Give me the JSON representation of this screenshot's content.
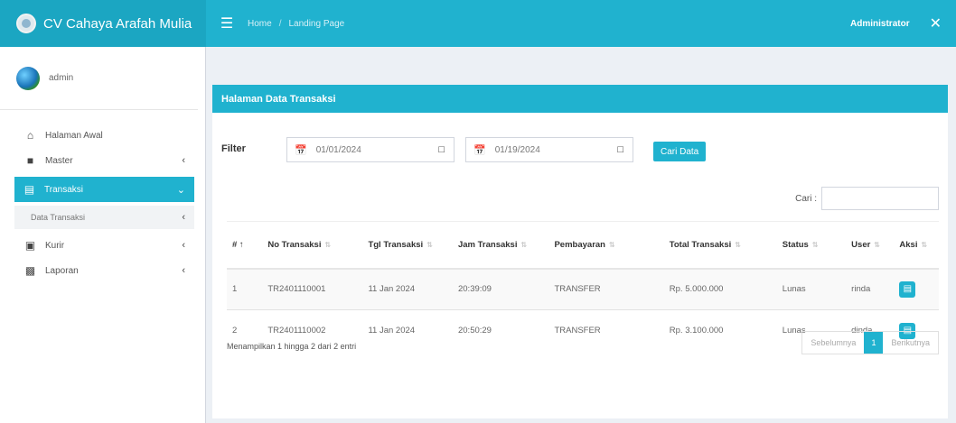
{
  "app": {
    "name": "CV Cahaya Arafah Mulia"
  },
  "header": {
    "breadcrumbs": [
      "Home",
      "Landing Page"
    ],
    "user": "Administrator"
  },
  "sidebar": {
    "user_name": "admin",
    "items": [
      {
        "label": "Halaman Awal",
        "icon": "home-icon",
        "chevron": false
      },
      {
        "label": "Master",
        "icon": "folder-icon",
        "chevron": true
      },
      {
        "label": "Transaksi",
        "icon": "table-icon",
        "chevron": true,
        "active": true
      },
      {
        "label": "Data Transaksi",
        "submenu": true,
        "chevron": true
      },
      {
        "label": "Kurir",
        "icon": "courier-icon",
        "chevron": true
      },
      {
        "label": "Laporan",
        "icon": "book-icon",
        "chevron": true
      }
    ]
  },
  "box": {
    "title": "Halaman Data Transaksi",
    "filter_label": "Filter",
    "date_from": "01/01/2024",
    "date_to": "01/19/2024",
    "search_button": "Cari Data",
    "search_label": "Cari :"
  },
  "table": {
    "headers": [
      "# ↑",
      "No Transaksi",
      "Tgl Transaksi",
      "Jam Transaksi",
      "Pembayaran",
      "Total Transaksi",
      "Status",
      "User",
      "Aksi"
    ],
    "rows": [
      [
        "1",
        "TR2401110001",
        "11 Jan 2024",
        "20:39:09",
        "TRANSFER",
        "Rp. 5.000.000",
        "Lunas",
        "rinda"
      ],
      [
        "2",
        "TR2401110002",
        "11 Jan 2024",
        "20:50:29",
        "TRANSFER",
        "Rp. 3.100.000",
        "Lunas",
        "dinda"
      ]
    ]
  },
  "footer": {
    "info": "Menampilkan 1 hingga 2 dari 2 entri",
    "prev": "Sebelumnya",
    "page": "1",
    "next": "Berikutnya"
  },
  "colors": {
    "accent": "#20b2cf",
    "background": "#ecf0f5"
  }
}
